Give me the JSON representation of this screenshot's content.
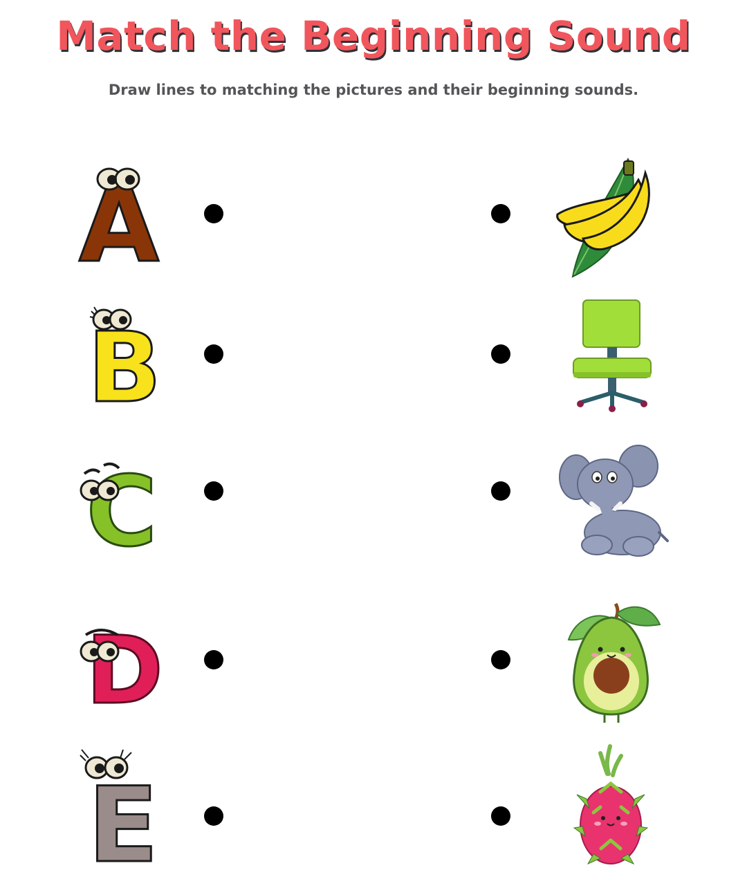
{
  "worksheet": {
    "title": "Match the Beginning Sound",
    "instructions": "Draw lines to matching the pictures and their beginning sounds."
  },
  "rows": [
    {
      "letter": "A",
      "letter_color": "#8a3508",
      "picture": "banana-icon"
    },
    {
      "letter": "B",
      "letter_color": "#f7e21c",
      "picture": "chair-icon"
    },
    {
      "letter": "C",
      "letter_color": "#86c128",
      "picture": "elephant-icon"
    },
    {
      "letter": "D",
      "letter_color": "#e01f58",
      "picture": "avocado-icon"
    },
    {
      "letter": "E",
      "letter_color": "#9a8c8a",
      "picture": "dragon-fruit-icon"
    }
  ],
  "colors": {
    "title": "#f0565c",
    "title_shadow": "#2f3138",
    "instructions": "#555558"
  }
}
